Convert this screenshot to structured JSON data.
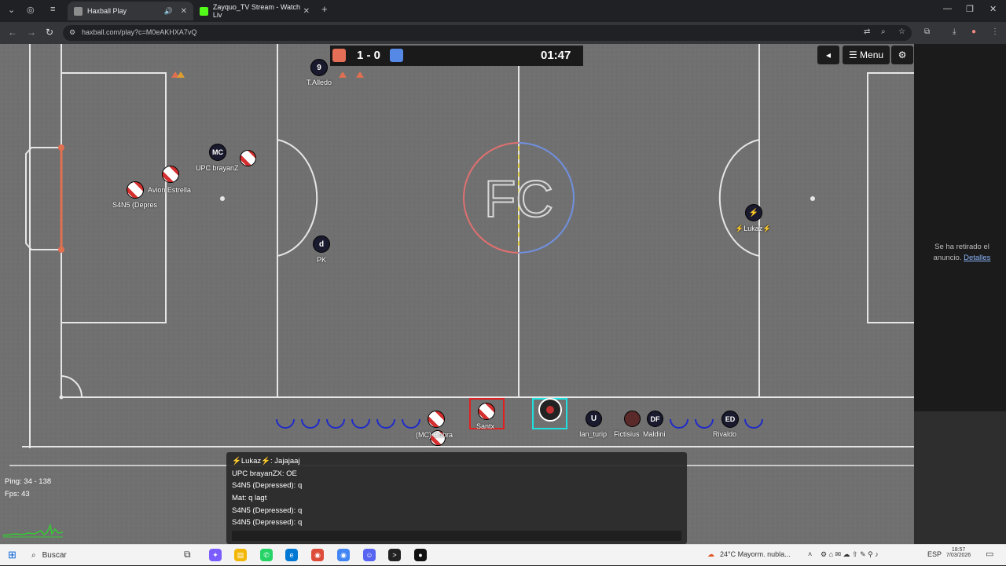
{
  "browser": {
    "tabs": [
      {
        "title": "Haxball Play",
        "active": true
      },
      {
        "title": "Zayquo_TV Stream - Watch Liv",
        "active": false
      }
    ],
    "url": "haxball.com/play?c=M0eAKHXA7vQ",
    "new_tab_label": "+"
  },
  "game": {
    "score_red": 1,
    "score_blue": 0,
    "score_text": "1 - 0",
    "timer": "01:47",
    "menu_label": "Menu",
    "center_logo": "FC",
    "players": [
      {
        "label": "9",
        "name": "T.Alledo",
        "team": "blue"
      },
      {
        "label": "MC",
        "name": "UPC brayanZ",
        "team": "blue"
      },
      {
        "label": "",
        "name": "Avion Estrella",
        "team": "flag"
      },
      {
        "label": "",
        "name": "S4N5 (Depres",
        "team": "flag"
      },
      {
        "label": "d",
        "name": "PK",
        "team": "blue"
      },
      {
        "label": "⚡",
        "name": "⚡Lukaz⚡",
        "team": "blue"
      },
      {
        "label": "",
        "name": "Santx",
        "team": "flag"
      },
      {
        "label": "",
        "name": "(MC) Cobra",
        "team": "flag"
      },
      {
        "label": "U",
        "name": "Ian_turip",
        "team": "blue"
      },
      {
        "label": "",
        "name": "Fictisius",
        "team": "blue"
      },
      {
        "label": "DF",
        "name": "Maldini",
        "team": "blue"
      },
      {
        "label": "ED",
        "name": "Rivaldo",
        "team": "blue"
      }
    ]
  },
  "ad": {
    "text": "Se ha retirado el anuncio.",
    "link": "Detalles"
  },
  "chat": {
    "lines": [
      "⚡Lukaz⚡: Jajajaaj",
      "UPC brayanZX: OE",
      "S4N5 (Depressed): q",
      "Mat: q lagt",
      "S4N5 (Depressed): q",
      "S4N5 (Depressed): q"
    ]
  },
  "stats": {
    "ping": "Ping: 34 - 138",
    "fps": "Fps: 43"
  },
  "taskbar": {
    "search": "Buscar",
    "weather": "24°C  Mayorm. nubla...",
    "lang": "ESP",
    "time": "18:57",
    "date": "7/03/2026"
  }
}
